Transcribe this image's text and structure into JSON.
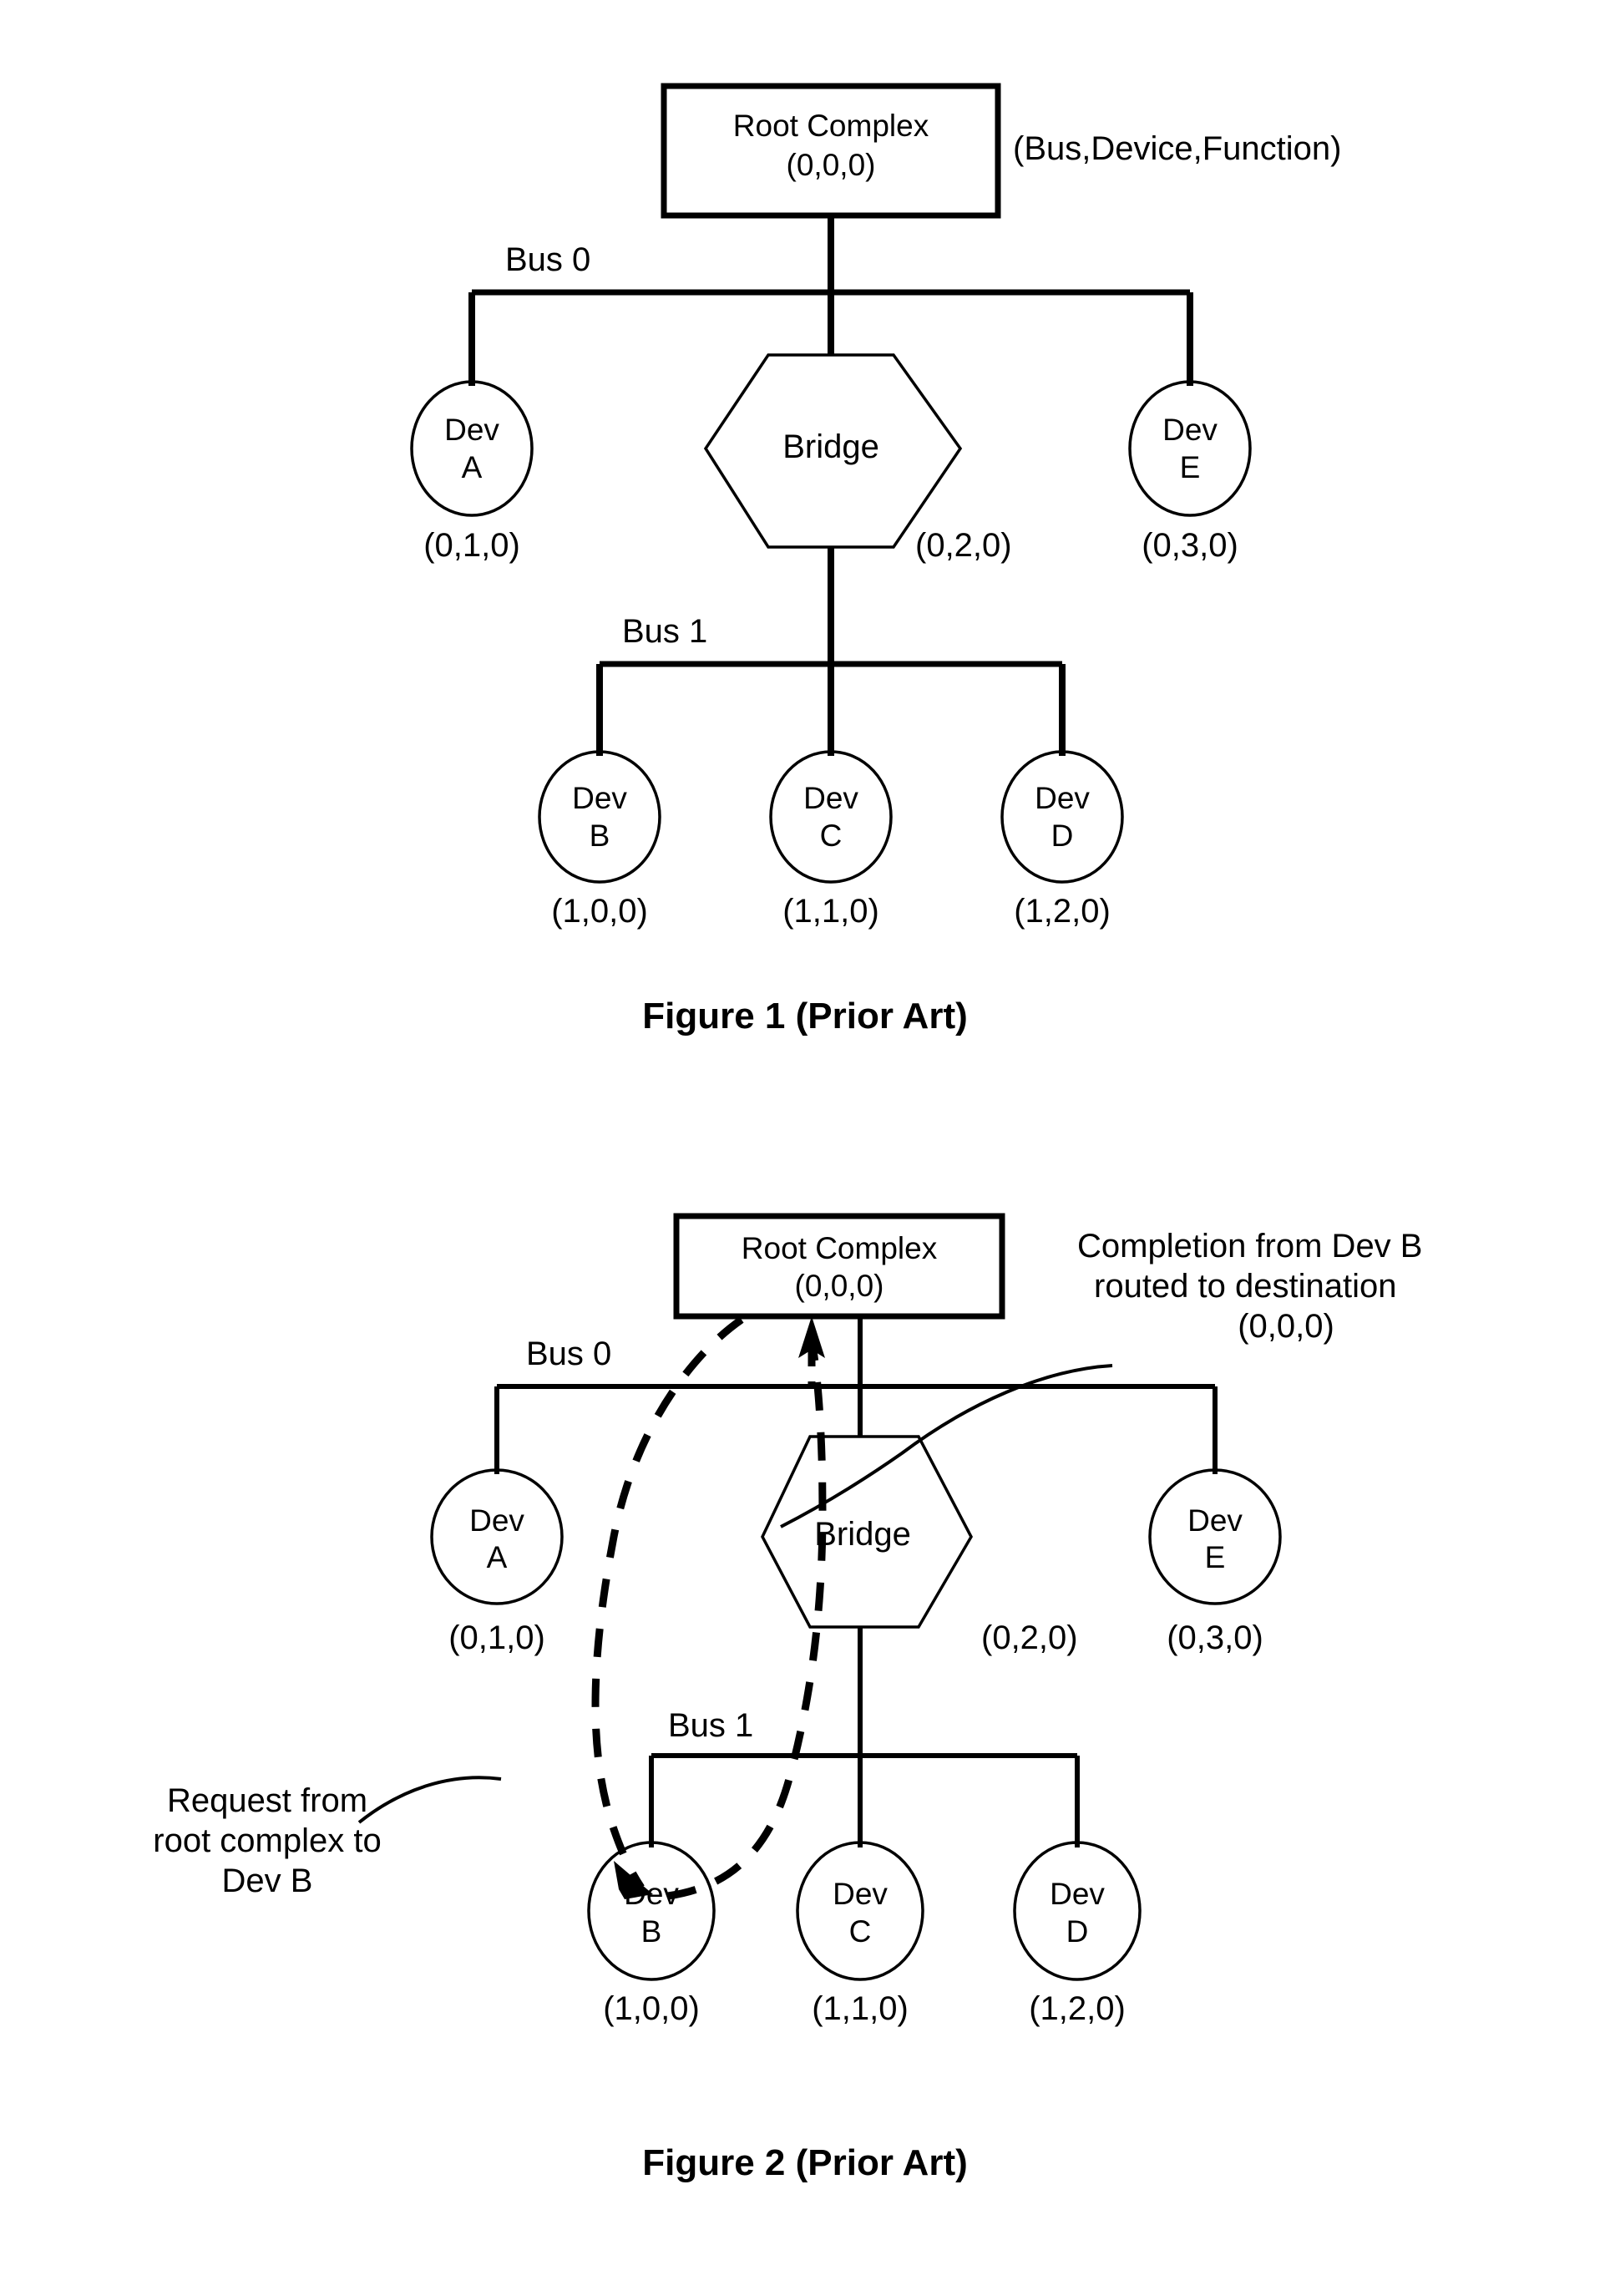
{
  "document": {
    "type": "patent-figure-sheet",
    "background_color": "#ffffff",
    "line_color": "#000000"
  },
  "figure1": {
    "caption": "Figure 1 (Prior Art)",
    "legend_note": "(Bus,Device,Function)",
    "root": {
      "label": "Root Complex",
      "address": "(0,0,0)",
      "shape": "rectangle"
    },
    "bus0_label": "Bus 0",
    "bus1_label": "Bus 1",
    "bridge": {
      "label": "Bridge",
      "address": "(0,2,0)",
      "shape": "hexagon"
    },
    "bus0_devices": [
      {
        "name": "Dev",
        "id": "A",
        "address": "(0,1,0)",
        "shape": "ellipse"
      },
      {
        "name": "Dev",
        "id": "E",
        "address": "(0,3,0)",
        "shape": "ellipse"
      }
    ],
    "bus1_devices": [
      {
        "name": "Dev",
        "id": "B",
        "address": "(1,0,0)",
        "shape": "ellipse"
      },
      {
        "name": "Dev",
        "id": "C",
        "address": "(1,1,0)",
        "shape": "ellipse"
      },
      {
        "name": "Dev",
        "id": "D",
        "address": "(1,2,0)",
        "shape": "ellipse"
      }
    ]
  },
  "figure2": {
    "caption": "Figure 2 (Prior Art)",
    "root": {
      "label": "Root Complex",
      "address": "(0,0,0)",
      "shape": "rectangle"
    },
    "bus0_label": "Bus 0",
    "bus1_label": "Bus 1",
    "bridge": {
      "label": "Bridge",
      "address": "(0,2,0)",
      "shape": "hexagon"
    },
    "bus0_devices": [
      {
        "name": "Dev",
        "id": "A",
        "address": "(0,1,0)",
        "shape": "ellipse"
      },
      {
        "name": "Dev",
        "id": "E",
        "address": "(0,3,0)",
        "shape": "ellipse"
      }
    ],
    "bus1_devices": [
      {
        "name": "Dev",
        "id": "B",
        "address": "(1,0,0)",
        "shape": "ellipse"
      },
      {
        "name": "Dev",
        "id": "C",
        "address": "(1,1,0)",
        "shape": "ellipse"
      },
      {
        "name": "Dev",
        "id": "D",
        "address": "(1,2,0)",
        "shape": "ellipse"
      }
    ],
    "annotations": {
      "completion": {
        "line1": "Completion from Dev B",
        "line2": "routed to destination",
        "line3": "(0,0,0)"
      },
      "request": {
        "line1": "Request from",
        "line2": "root complex to",
        "line3": "Dev B"
      }
    }
  }
}
